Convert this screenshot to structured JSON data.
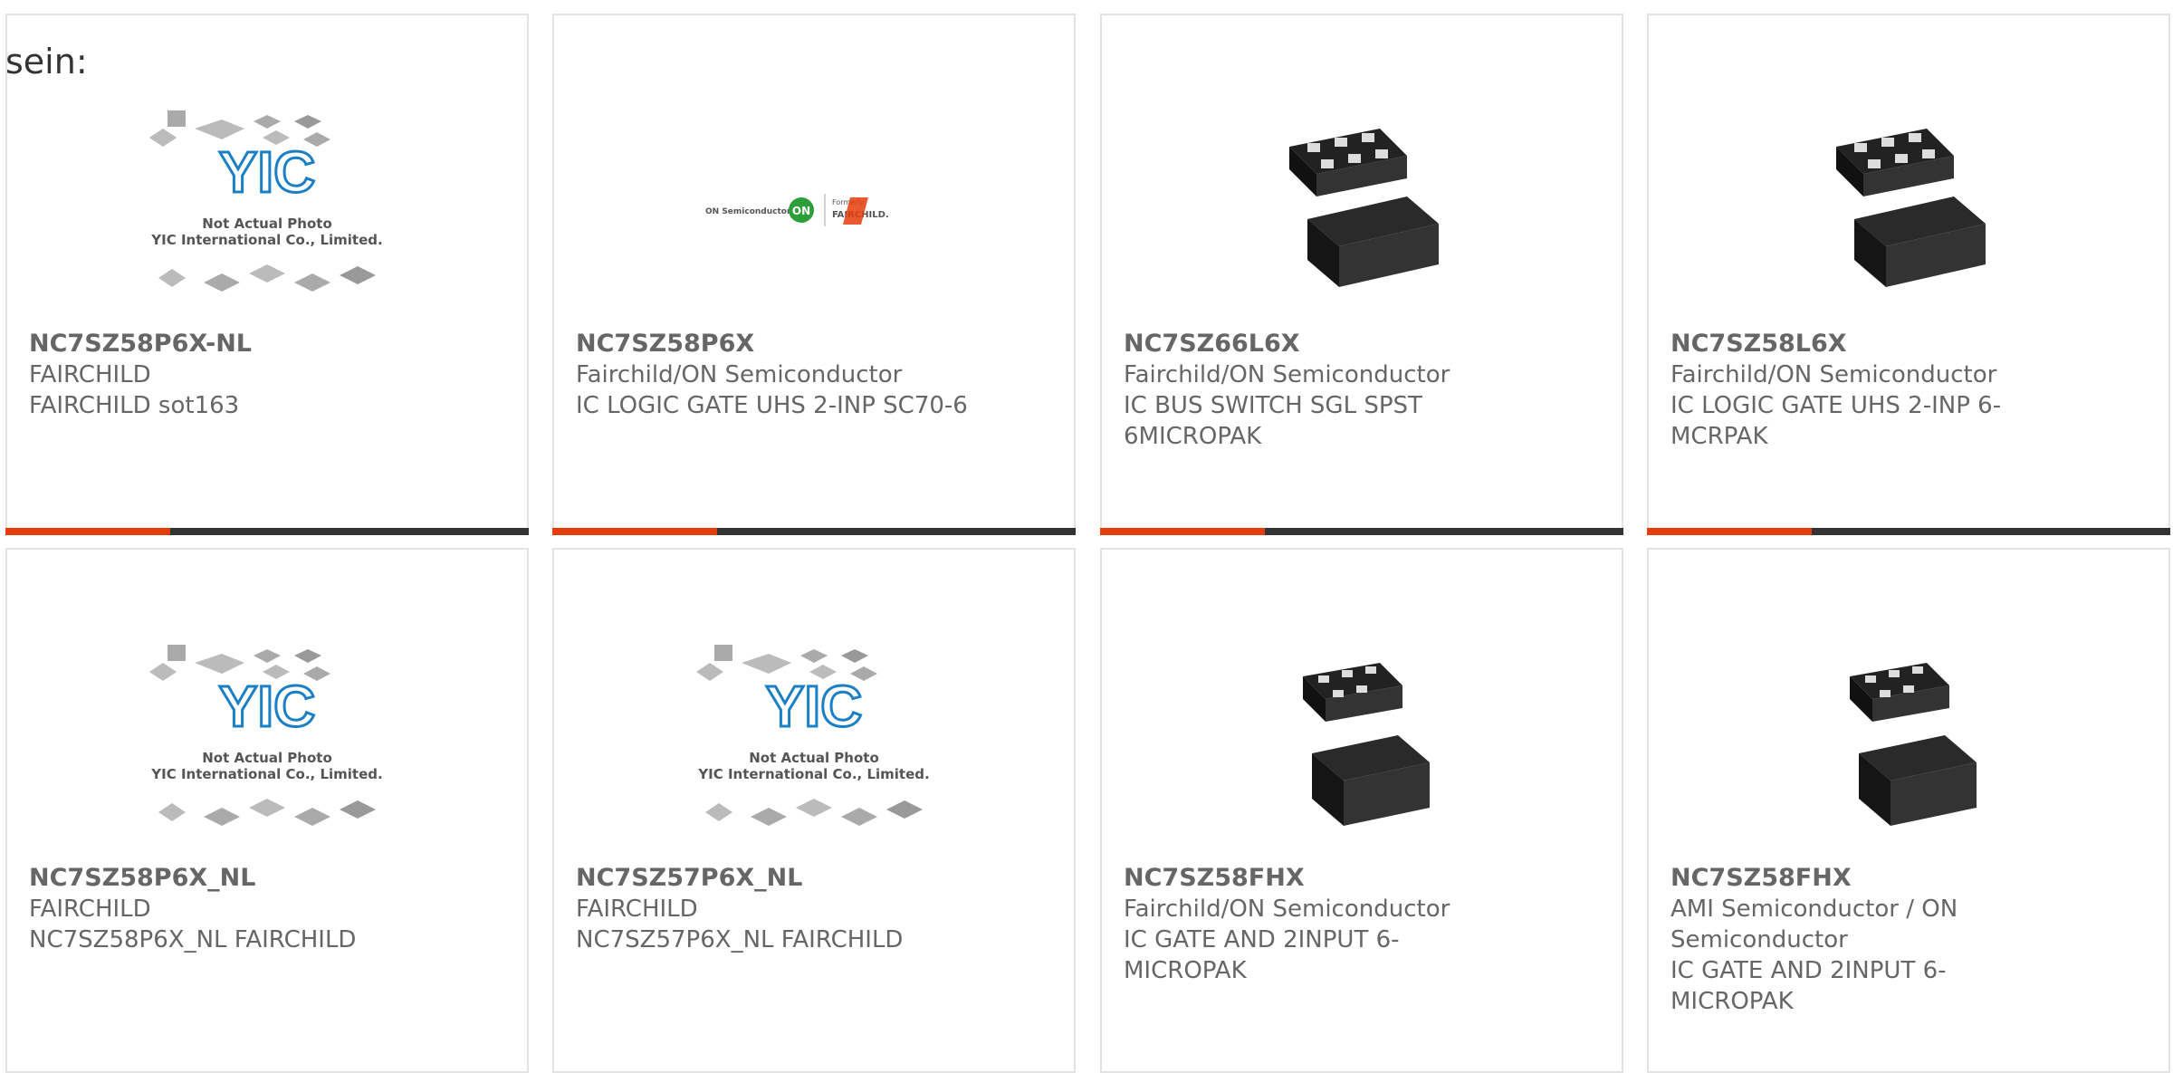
{
  "page": {
    "lead_text": "sein:"
  },
  "placeholder": {
    "logo_text": "YIC",
    "line1": "Not Actual Photo",
    "line2": "YIC International Co., Limited."
  },
  "logo_strip": {
    "left_text": "ON Semiconductor",
    "middle_text": "ON",
    "right_top": "Formerly",
    "right_text": "FAIRCHILD."
  },
  "colors": {
    "accent": "#e53d0a",
    "bar": "#333333",
    "border": "#e3e3e3",
    "yic_blue": "#1a7fc4"
  },
  "products": [
    {
      "part": "NC7SZ58P6X-NL",
      "maker": "FAIRCHILD",
      "desc": "FAIRCHILD sot163",
      "image": "placeholder"
    },
    {
      "part": "NC7SZ58P6X",
      "maker": "Fairchild/ON Semiconductor",
      "desc": "IC LOGIC GATE UHS 2-INP SC70-6",
      "image": "logo-strip"
    },
    {
      "part": "NC7SZ66L6X",
      "maker": "Fairchild/ON Semiconductor",
      "desc": "IC BUS SWITCH SGL SPST 6MICROPAK",
      "image": "chip"
    },
    {
      "part": "NC7SZ58L6X",
      "maker": "Fairchild/ON Semiconductor",
      "desc": "IC LOGIC GATE UHS 2-INP 6-MCRPAK",
      "image": "chip"
    },
    {
      "part": "NC7SZ58P6X_NL",
      "maker": "FAIRCHILD",
      "desc": "NC7SZ58P6X_NL FAIRCHILD",
      "image": "placeholder"
    },
    {
      "part": "NC7SZ57P6X_NL",
      "maker": "FAIRCHILD",
      "desc": "NC7SZ57P6X_NL FAIRCHILD",
      "image": "placeholder"
    },
    {
      "part": "NC7SZ58FHX",
      "maker": "Fairchild/ON Semiconductor",
      "desc": "IC GATE AND 2INPUT 6-MICROPAK",
      "image": "chip"
    },
    {
      "part": "NC7SZ58FHX",
      "maker": "AMI Semiconductor / ON Semiconductor",
      "desc": "IC GATE AND 2INPUT 6-MICROPAK",
      "image": "chip"
    }
  ]
}
